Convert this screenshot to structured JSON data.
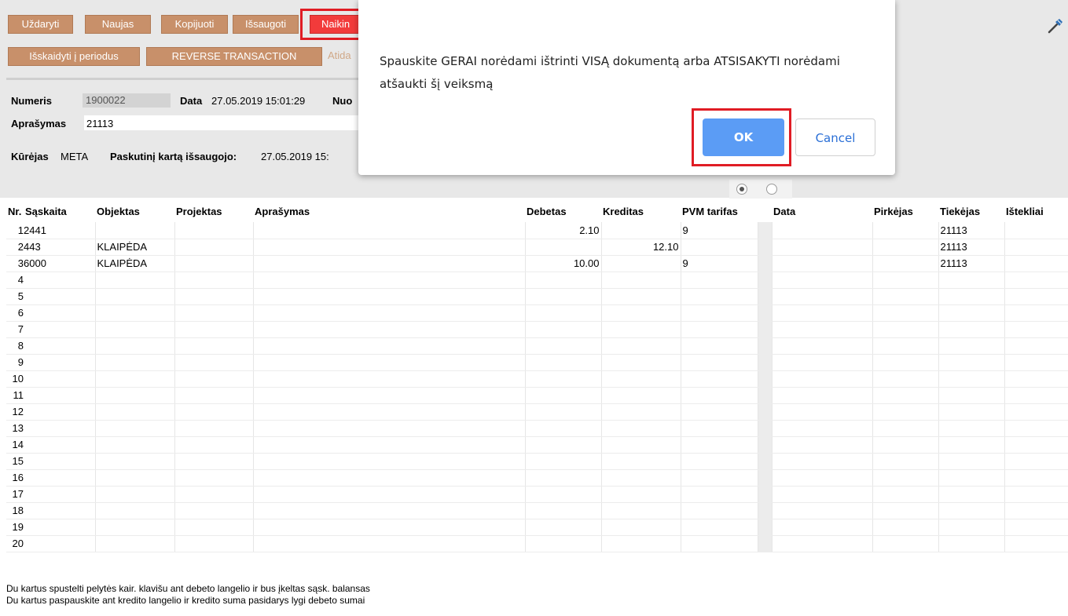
{
  "toolbar": {
    "row1": [
      "Uždaryti",
      "Naujas",
      "Kopijuoti",
      "Išsaugoti",
      "Naikin"
    ],
    "row2": [
      "Išskaidyti į periodus",
      "REVERSE TRANSACTION"
    ],
    "faded": "Atida"
  },
  "header": {
    "numeris_label": "Numeris",
    "numeris_value": "1900022",
    "data_label": "Data",
    "data_value": "27.05.2019 15:01:29",
    "nuo_label": "Nuo",
    "aprasymas_label": "Aprašymas",
    "aprasymas_value": "21113",
    "kurejas_label": "Kūrėjas",
    "kurejas_value": "META",
    "paskutini_label": "Paskutinį kartą išsaugojo:",
    "paskutini_value": "27.05.2019 15:"
  },
  "table": {
    "columns": [
      "Nr.",
      "Sąskaita",
      "Objektas",
      "Projektas",
      "Aprašymas",
      "Debetas",
      "Kreditas",
      "PVM tarifas",
      "Data",
      "Pirkėjas",
      "Tiekėjas",
      "Ištekliai"
    ],
    "rows": [
      {
        "nr": "1",
        "saskaita": "2441",
        "objektas": "",
        "projektas": "",
        "aprasymas": "",
        "debetas": "2.10",
        "kreditas": "",
        "pvm": "9",
        "data": "",
        "pirkejas": "",
        "tiekejas": "21113",
        "istekliai": ""
      },
      {
        "nr": "2",
        "saskaita": "443",
        "objektas": "KLAIPĖDA",
        "projektas": "",
        "aprasymas": "",
        "debetas": "",
        "kreditas": "12.10",
        "pvm": "",
        "data": "",
        "pirkejas": "",
        "tiekejas": "21113",
        "istekliai": ""
      },
      {
        "nr": "3",
        "saskaita": "6000",
        "objektas": "KLAIPĖDA",
        "projektas": "",
        "aprasymas": "",
        "debetas": "10.00",
        "kreditas": "",
        "pvm": "9",
        "data": "",
        "pirkejas": "",
        "tiekejas": "21113",
        "istekliai": ""
      },
      {
        "nr": "4"
      },
      {
        "nr": "5"
      },
      {
        "nr": "6"
      },
      {
        "nr": "7"
      },
      {
        "nr": "8"
      },
      {
        "nr": "9"
      },
      {
        "nr": "10"
      },
      {
        "nr": "11"
      },
      {
        "nr": "12"
      },
      {
        "nr": "13"
      },
      {
        "nr": "14"
      },
      {
        "nr": "15"
      },
      {
        "nr": "16"
      },
      {
        "nr": "17"
      },
      {
        "nr": "18"
      },
      {
        "nr": "19"
      },
      {
        "nr": "20"
      }
    ]
  },
  "footer": {
    "line1": "Du kartus spustelti pelytės kair. klavišu ant debeto langelio ir bus įkeltas sąsk. balansas",
    "line2": "Du kartus paspauskite ant kredito langelio ir kredito suma pasidarys lygi debeto sumai"
  },
  "dialog": {
    "message": "Spauskite GERAI norėdami ištrinti VISĄ dokumentą arba ATSISAKYTI norėdami atšaukti šį veiksmą",
    "ok_label": "OK",
    "cancel_label": "Cancel"
  },
  "colors": {
    "button": "#c8906a",
    "delete_button": "#f23b3b",
    "highlight": "#e01c24",
    "ok_button": "#5b9cf5"
  },
  "icons": [
    "tools-icon"
  ]
}
